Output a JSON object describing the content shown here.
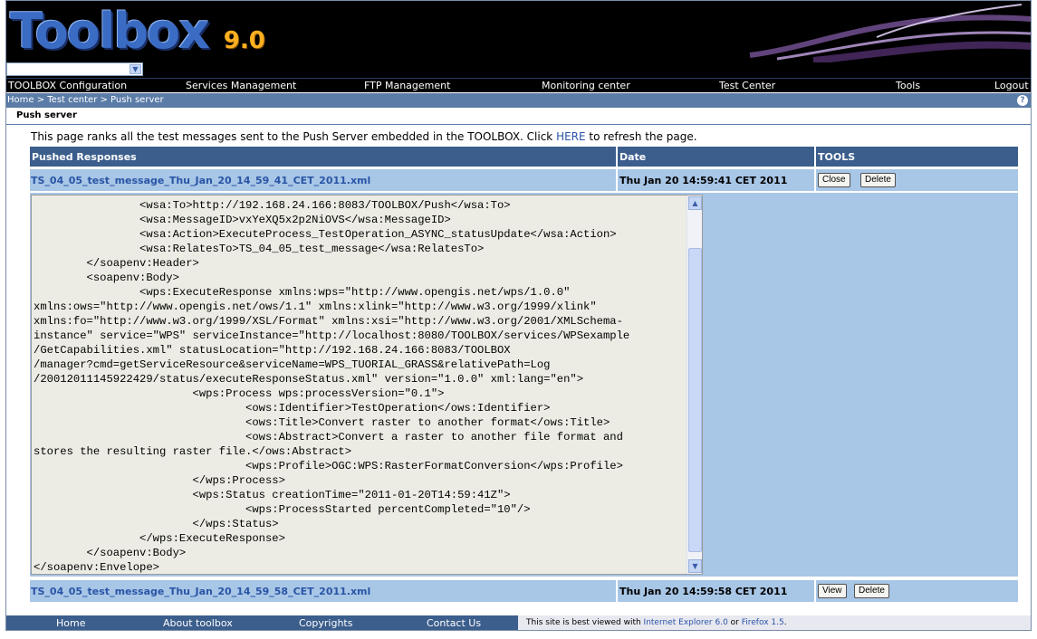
{
  "header": {
    "logo_text": "Toolbox",
    "logo_version": "9.0",
    "project_select_value": ""
  },
  "menu": [
    {
      "label": "TOOLBOX Configuration"
    },
    {
      "label": "Services Management"
    },
    {
      "label": "FTP Management"
    },
    {
      "label": "Monitoring center"
    },
    {
      "label": "Test Center"
    },
    {
      "label": "Tools"
    },
    {
      "label": "Logout"
    }
  ],
  "breadcrumb": "Home > Test center > Push server",
  "help_icon": "?",
  "page_title": "Push server",
  "intro": {
    "before": "This page ranks all the test messages sent to the Push Server embedded in the TOOLBOX. Click ",
    "link": "HERE",
    "after": " to refresh the page."
  },
  "table": {
    "headers": [
      "Pushed Responses",
      "Date",
      "TOOLS"
    ],
    "rows": [
      {
        "name": "TS_04_05_test_message_Thu_Jan_20_14_59_41_CET_2011.xml",
        "date": "Thu Jan 20 14:59:41 CET 2011",
        "btn1": "Close",
        "btn2": "Delete"
      },
      {
        "name": "TS_04_05_test_message_Thu_Jan_20_14_59_58_CET_2011.xml",
        "date": "Thu Jan 20 14:59:58 CET 2011",
        "btn1": "View",
        "btn2": "Delete"
      }
    ]
  },
  "xml_content": "                <wsa:To>http://192.168.24.166:8083/TOOLBOX/Push</wsa:To>\n                <wsa:MessageID>vxYeXQ5x2p2NiOVS</wsa:MessageID>\n                <wsa:Action>ExecuteProcess_TestOperation_ASYNC_statusUpdate</wsa:Action>\n                <wsa:RelatesTo>TS_04_05_test_message</wsa:RelatesTo>\n        </soapenv:Header>\n        <soapenv:Body>\n                <wps:ExecuteResponse xmlns:wps=\"http://www.opengis.net/wps/1.0.0\"\nxmlns:ows=\"http://www.opengis.net/ows/1.1\" xmlns:xlink=\"http://www.w3.org/1999/xlink\"\nxmlns:fo=\"http://www.w3.org/1999/XSL/Format\" xmlns:xsi=\"http://www.w3.org/2001/XMLSchema-\ninstance\" service=\"WPS\" serviceInstance=\"http://localhost:8080/TOOLBOX/services/WPSexample\n/GetCapabilities.xml\" statusLocation=\"http://192.168.24.166:8083/TOOLBOX\n/manager?cmd=getServiceResource&serviceName=WPS_TUORIAL_GRASS&relativePath=Log\n/20012011145922429/status/executeResponseStatus.xml\" version=\"1.0.0\" xml:lang=\"en\">\n                        <wps:Process wps:processVersion=\"0.1\">\n                                <ows:Identifier>TestOperation</ows:Identifier>\n                                <ows:Title>Convert raster to another format</ows:Title>\n                                <ows:Abstract>Convert a raster to another file format and\nstores the resulting raster file.</ows:Abstract>\n                                <wps:Profile>OGC:WPS:RasterFormatConversion</wps:Profile>\n                        </wps:Process>\n                        <wps:Status creationTime=\"2011-01-20T14:59:41Z\">\n                                <wps:ProcessStarted percentCompleted=\"10\"/>\n                        </wps:Status>\n                </wps:ExecuteResponse>\n        </soapenv:Body>\n</soapenv:Envelope>",
  "footer": {
    "links": [
      "Home",
      "About toolbox",
      "Copyrights",
      "Contact Us"
    ],
    "note_before": "This site is best viewed with ",
    "note_link1": "Internet Explorer 6.0",
    "note_mid": " or ",
    "note_link2": "Firefox 1.5",
    "note_after": "."
  },
  "icons": {
    "dropdown": "chevron-down-icon",
    "scroll_up": "arrow-up-icon",
    "scroll_down": "arrow-down-icon",
    "help": "help-icon"
  },
  "colors": {
    "header_bar": "#3b5e8c",
    "row_bg": "#a8c6e6",
    "link": "#2a55a6",
    "crumb_bar": "#5b7ca7"
  }
}
